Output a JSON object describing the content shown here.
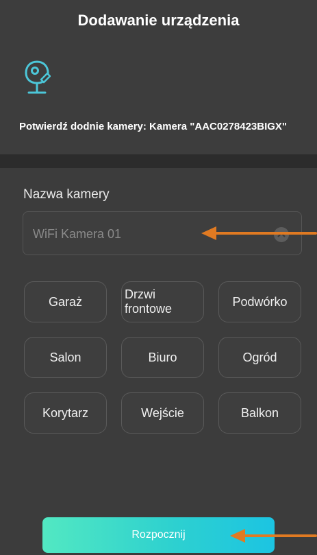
{
  "header": {
    "title": "Dodawanie urządzenia",
    "confirm_text": "Potwierdź dodnie kamery: Kamera \"AAC0278423BIGX\""
  },
  "form": {
    "name_label": "Nazwa kamery",
    "name_placeholder": "WiFi Kamera 01"
  },
  "presets": [
    "Garaż",
    "Drzwi frontowe",
    "Podwórko",
    "Salon",
    "Biuro",
    "Ogród",
    "Korytarz",
    "Wejście",
    "Balkon"
  ],
  "start_button_label": "Rozpocznij",
  "colors": {
    "background": "#3a3a3a",
    "annotation_arrow": "#e07a22",
    "button_gradient_start": "#52e8c2",
    "button_gradient_end": "#1cc4e2",
    "camera_icon": "#4cc7d9"
  }
}
